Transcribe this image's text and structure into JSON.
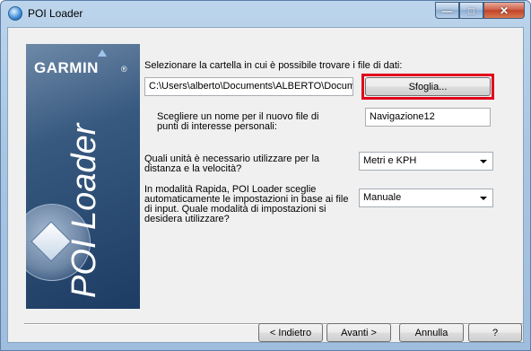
{
  "window": {
    "title": "POI Loader"
  },
  "brand": {
    "logo": "GARMIN",
    "product": "POI Loader",
    "reg_mark": "®"
  },
  "folder": {
    "label": "Selezionare la cartella in cui è possibile trovare i file di dati:",
    "path": "C:\\Users\\alberto\\Documents\\ALBERTO\\Documer",
    "browse_label": "Sfoglia..."
  },
  "filename": {
    "label": "Scegliere un nome per il nuovo file di punti di interesse personali:",
    "value": "Navigazione12"
  },
  "units": {
    "label": "Quali unità è necessario utilizzare per la distanza e la velocità?",
    "value": "Metri e KPH"
  },
  "mode": {
    "label": "In modalità Rapida, POI Loader sceglie automaticamente le impostazioni in base ai file di input. Quale modalità di impostazioni si desidera utilizzare?",
    "value": "Manuale"
  },
  "footer": {
    "back": "< Indietro",
    "next": "Avanti >",
    "cancel": "Annulla",
    "help": "?"
  },
  "colors": {
    "highlight": "#e2001a",
    "panel": "#1d3c63"
  }
}
